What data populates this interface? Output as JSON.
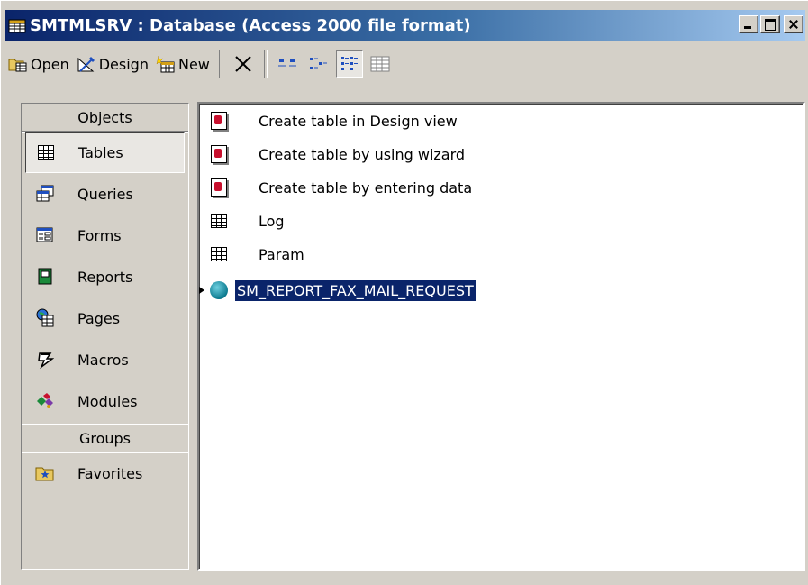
{
  "window": {
    "title": "SMTMLSRV : Database (Access 2000 file format)"
  },
  "toolbar": {
    "open_label": "Open",
    "design_label": "Design",
    "new_label": "New"
  },
  "objects_bar": {
    "objects_header": "Objects",
    "groups_header": "Groups",
    "items": [
      {
        "label": "Tables",
        "icon": "table-icon",
        "selected": true
      },
      {
        "label": "Queries",
        "icon": "query-icon"
      },
      {
        "label": "Forms",
        "icon": "form-icon"
      },
      {
        "label": "Reports",
        "icon": "report-icon"
      },
      {
        "label": "Pages",
        "icon": "page-icon"
      },
      {
        "label": "Macros",
        "icon": "macro-icon"
      },
      {
        "label": "Modules",
        "icon": "module-icon"
      }
    ],
    "groups": [
      {
        "label": "Favorites",
        "icon": "favorites-icon"
      }
    ]
  },
  "list": {
    "items": [
      {
        "label": "Create table in Design view",
        "icon": "wizard-icon"
      },
      {
        "label": "Create table by using wizard",
        "icon": "wizard-icon"
      },
      {
        "label": "Create table by entering data",
        "icon": "wizard-icon"
      },
      {
        "label": "Log",
        "icon": "table-icon"
      },
      {
        "label": "Param",
        "icon": "table-icon"
      },
      {
        "label": "SM_REPORT_FAX_MAIL_REQUEST",
        "icon": "linked-table-icon",
        "selected": true
      }
    ]
  }
}
